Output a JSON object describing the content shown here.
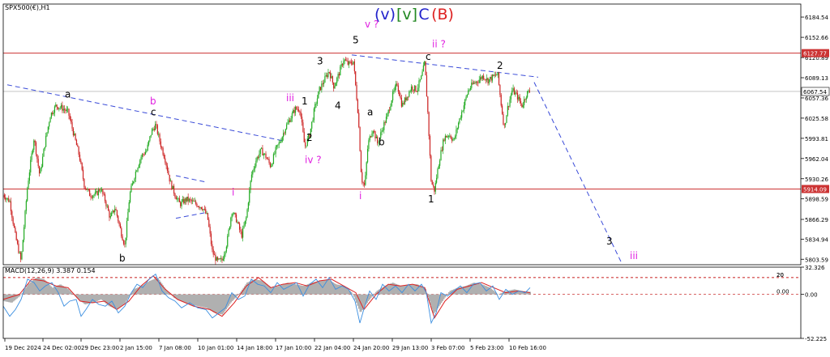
{
  "chart_data": {
    "type": "candlestick",
    "symbol": "SPX500(€),H1",
    "title_parts": [
      {
        "text": "(v)",
        "color": "#2222cc",
        "x": 475,
        "boxed": false
      },
      {
        "text": "[v]",
        "color": "#228822",
        "x": 502,
        "boxed": true
      },
      {
        "text": "C",
        "color": "#2222cc",
        "x": 523,
        "boxed": false
      },
      {
        "text": "(B)",
        "color": "#dd2222",
        "x": 546,
        "boxed": false
      }
    ],
    "ylim": [
      5795,
      6205
    ],
    "yticks": [
      6184.54,
      6152.66,
      6120.89,
      6089.13,
      6057.36,
      6025.58,
      5993.81,
      5962.04,
      5930.26,
      5898.59,
      5866.29,
      5834.94,
      5803.59
    ],
    "xticks": [
      "19 Dec 2024",
      "24 Dec 02:00",
      "29 Dec 23:00",
      "2 Jan 15:00",
      "7 Jan 08:00",
      "10 Jan 01:00",
      "14 Jan 18:00",
      "17 Jan 10:00",
      "22 Jan 04:00",
      "24 Jan 20:00",
      "29 Jan 13:00",
      "3 Feb 07:00",
      "5 Feb 23:00",
      "10 Feb 16:00"
    ],
    "horizontal_levels": [
      {
        "value": 6127.77,
        "label": "6127.77",
        "color": "#cc3333"
      },
      {
        "value": 5914.09,
        "label": "5914.09",
        "color": "#cc3333"
      }
    ],
    "current_price": {
      "value": 6067.54,
      "label": "6067.54"
    },
    "price_path": [
      [
        0,
        5905
      ],
      [
        8,
        5895
      ],
      [
        15,
        5840
      ],
      [
        22,
        5800
      ],
      [
        30,
        5920
      ],
      [
        38,
        5995
      ],
      [
        45,
        5935
      ],
      [
        52,
        5990
      ],
      [
        58,
        6030
      ],
      [
        65,
        6045
      ],
      [
        72,
        6042
      ],
      [
        80,
        6035
      ],
      [
        87,
        6000
      ],
      [
        94,
        5965
      ],
      [
        100,
        5920
      ],
      [
        107,
        5905
      ],
      [
        114,
        5905
      ],
      [
        120,
        5915
      ],
      [
        126,
        5895
      ],
      [
        132,
        5868
      ],
      [
        138,
        5885
      ],
      [
        145,
        5848
      ],
      [
        150,
        5825
      ],
      [
        156,
        5905
      ],
      [
        163,
        5940
      ],
      [
        170,
        5965
      ],
      [
        177,
        5975
      ],
      [
        183,
        6005
      ],
      [
        188,
        6015
      ],
      [
        194,
        5985
      ],
      [
        200,
        5960
      ],
      [
        206,
        5925
      ],
      [
        212,
        5905
      ],
      [
        218,
        5890
      ],
      [
        226,
        5898
      ],
      [
        236,
        5892
      ],
      [
        246,
        5885
      ],
      [
        252,
        5870
      ],
      [
        258,
        5815
      ],
      [
        264,
        5800
      ],
      [
        270,
        5802
      ],
      [
        276,
        5830
      ],
      [
        282,
        5880
      ],
      [
        288,
        5865
      ],
      [
        294,
        5840
      ],
      [
        300,
        5870
      ],
      [
        306,
        5935
      ],
      [
        312,
        5960
      ],
      [
        318,
        5975
      ],
      [
        324,
        5965
      ],
      [
        330,
        5950
      ],
      [
        336,
        5975
      ],
      [
        342,
        5990
      ],
      [
        348,
        6010
      ],
      [
        354,
        6025
      ],
      [
        360,
        6040
      ],
      [
        366,
        6040
      ],
      [
        372,
        5980
      ],
      [
        378,
        6000
      ],
      [
        384,
        6040
      ],
      [
        390,
        6070
      ],
      [
        396,
        6085
      ],
      [
        402,
        6100
      ],
      [
        408,
        6075
      ],
      [
        414,
        6095
      ],
      [
        420,
        6118
      ],
      [
        426,
        6110
      ],
      [
        432,
        6115
      ],
      [
        438,
        6030
      ],
      [
        442,
        5930
      ],
      [
        446,
        5918
      ],
      [
        450,
        5985
      ],
      [
        456,
        6010
      ],
      [
        462,
        5985
      ],
      [
        468,
        6010
      ],
      [
        474,
        6030
      ],
      [
        480,
        6060
      ],
      [
        486,
        6080
      ],
      [
        492,
        6045
      ],
      [
        498,
        6060
      ],
      [
        504,
        6075
      ],
      [
        510,
        6070
      ],
      [
        516,
        6090
      ],
      [
        520,
        6113
      ],
      [
        524,
        6030
      ],
      [
        528,
        5925
      ],
      [
        532,
        5912
      ],
      [
        538,
        5960
      ],
      [
        544,
        5995
      ],
      [
        550,
        6000
      ],
      [
        556,
        5990
      ],
      [
        562,
        6020
      ],
      [
        568,
        6045
      ],
      [
        574,
        6070
      ],
      [
        580,
        6080
      ],
      [
        586,
        6085
      ],
      [
        592,
        6092
      ],
      [
        598,
        6085
      ],
      [
        604,
        6090
      ],
      [
        610,
        6095
      ],
      [
        614,
        6050
      ],
      [
        618,
        6010
      ],
      [
        622,
        6040
      ],
      [
        628,
        6070
      ],
      [
        634,
        6060
      ],
      [
        640,
        6045
      ],
      [
        646,
        6065
      ],
      [
        650,
        6068
      ]
    ],
    "trendlines": [
      {
        "name": "upper-channel",
        "points": [
          [
            430,
            6125
          ],
          [
            660,
            6090
          ]
        ],
        "color": "#3a4bd8"
      },
      {
        "name": "left-channel",
        "points": [
          [
            5,
            6078
          ],
          [
            345,
            5990
          ]
        ],
        "color": "#3a4bd8"
      },
      {
        "name": "projection",
        "points": [
          [
            655,
            6082
          ],
          [
            762,
            5800
          ]
        ],
        "color": "#3a4bd8"
      },
      {
        "name": "small-channel-upper",
        "points": [
          [
            213,
            5935
          ],
          [
            250,
            5925
          ]
        ],
        "color": "#3a4bd8"
      },
      {
        "name": "small-channel-lower",
        "points": [
          [
            213,
            5868
          ],
          [
            250,
            5877
          ]
        ],
        "color": "#3a4bd8"
      }
    ],
    "wave_labels": [
      {
        "text": "a",
        "x": 80,
        "v": 6058,
        "color": "#000000"
      },
      {
        "text": "b",
        "x": 185,
        "v": 6047,
        "color": "#e020e0"
      },
      {
        "text": "c",
        "x": 186,
        "v": 6030,
        "color": "#000000"
      },
      {
        "text": "b",
        "x": 147,
        "v": 5800,
        "color": "#000000"
      },
      {
        "text": "i",
        "x": 286,
        "v": 5904,
        "color": "#e020e0"
      },
      {
        "text": "iii",
        "x": 353,
        "v": 6052,
        "color": "#e020e0"
      },
      {
        "text": "1",
        "x": 372,
        "v": 6047,
        "color": "#000000"
      },
      {
        "text": "2",
        "x": 378,
        "v": 5990,
        "color": "#000000"
      },
      {
        "text": "iv ?",
        "x": 376,
        "v": 5955,
        "color": "#e020e0"
      },
      {
        "text": "3",
        "x": 391,
        "v": 6110,
        "color": "#000000"
      },
      {
        "text": "4",
        "x": 413,
        "v": 6040,
        "color": "#000000"
      },
      {
        "text": "5",
        "x": 435,
        "v": 6143,
        "color": "#000000"
      },
      {
        "text": "v ?",
        "x": 450,
        "v": 6168,
        "color": "#e020e0"
      },
      {
        "text": "a",
        "x": 453,
        "v": 6030,
        "color": "#000000"
      },
      {
        "text": "b",
        "x": 467,
        "v": 5983,
        "color": "#000000"
      },
      {
        "text": "i",
        "x": 443,
        "v": 5898,
        "color": "#e020e0"
      },
      {
        "text": "ii ?",
        "x": 533,
        "v": 6137,
        "color": "#e020e0"
      },
      {
        "text": "c",
        "x": 525,
        "v": 6117,
        "color": "#000000"
      },
      {
        "text": "1",
        "x": 528,
        "v": 5893,
        "color": "#000000"
      },
      {
        "text": "2",
        "x": 613,
        "v": 6103,
        "color": "#000000"
      },
      {
        "text": "3",
        "x": 748,
        "v": 5827,
        "color": "#000000"
      },
      {
        "text": "iii",
        "x": 777,
        "v": 5804,
        "color": "#e020e0"
      }
    ],
    "macd": {
      "label": "MACD(12,26,9) 3.387 0.154",
      "ylim": [
        -52.225,
        32.326
      ],
      "yticks": [
        32.326,
        0.0,
        -52.225
      ],
      "levels": [
        20,
        0,
        -20
      ],
      "level_labels": [
        "20",
        "0.00",
        "20"
      ],
      "histogram": [
        [
          0,
          -8
        ],
        [
          10,
          -10
        ],
        [
          20,
          -2
        ],
        [
          30,
          12
        ],
        [
          40,
          20
        ],
        [
          50,
          18
        ],
        [
          60,
          8
        ],
        [
          70,
          12
        ],
        [
          80,
          6
        ],
        [
          90,
          -4
        ],
        [
          100,
          -12
        ],
        [
          110,
          -10
        ],
        [
          120,
          -6
        ],
        [
          130,
          -14
        ],
        [
          140,
          -18
        ],
        [
          150,
          -10
        ],
        [
          160,
          6
        ],
        [
          170,
          10
        ],
        [
          180,
          16
        ],
        [
          190,
          20
        ],
        [
          200,
          6
        ],
        [
          210,
          -4
        ],
        [
          220,
          -8
        ],
        [
          230,
          -12
        ],
        [
          240,
          -14
        ],
        [
          250,
          -16
        ],
        [
          260,
          -22
        ],
        [
          270,
          -24
        ],
        [
          280,
          -10
        ],
        [
          290,
          0
        ],
        [
          300,
          14
        ],
        [
          310,
          18
        ],
        [
          320,
          16
        ],
        [
          330,
          8
        ],
        [
          340,
          10
        ],
        [
          350,
          14
        ],
        [
          360,
          12
        ],
        [
          370,
          10
        ],
        [
          380,
          14
        ],
        [
          390,
          16
        ],
        [
          400,
          18
        ],
        [
          410,
          12
        ],
        [
          420,
          10
        ],
        [
          430,
          2
        ],
        [
          440,
          -22
        ],
        [
          450,
          -8
        ],
        [
          460,
          4
        ],
        [
          470,
          10
        ],
        [
          480,
          14
        ],
        [
          490,
          10
        ],
        [
          500,
          12
        ],
        [
          510,
          12
        ],
        [
          520,
          8
        ],
        [
          530,
          -24
        ],
        [
          540,
          -10
        ],
        [
          550,
          4
        ],
        [
          560,
          8
        ],
        [
          570,
          10
        ],
        [
          580,
          14
        ],
        [
          590,
          12
        ],
        [
          600,
          8
        ],
        [
          610,
          0
        ],
        [
          620,
          4
        ],
        [
          630,
          6
        ],
        [
          640,
          4
        ],
        [
          650,
          3
        ]
      ],
      "signal": [
        [
          0,
          -6
        ],
        [
          20,
          0
        ],
        [
          35,
          18
        ],
        [
          50,
          16
        ],
        [
          65,
          10
        ],
        [
          80,
          8
        ],
        [
          95,
          -8
        ],
        [
          110,
          -10
        ],
        [
          125,
          -8
        ],
        [
          140,
          -18
        ],
        [
          155,
          -8
        ],
        [
          170,
          10
        ],
        [
          185,
          22
        ],
        [
          200,
          6
        ],
        [
          215,
          -6
        ],
        [
          235,
          -14
        ],
        [
          255,
          -18
        ],
        [
          270,
          -26
        ],
        [
          285,
          -10
        ],
        [
          300,
          10
        ],
        [
          315,
          20
        ],
        [
          330,
          8
        ],
        [
          345,
          12
        ],
        [
          360,
          14
        ],
        [
          375,
          10
        ],
        [
          390,
          16
        ],
        [
          405,
          18
        ],
        [
          420,
          10
        ],
        [
          435,
          2
        ],
        [
          445,
          -18
        ],
        [
          460,
          0
        ],
        [
          475,
          12
        ],
        [
          490,
          10
        ],
        [
          505,
          12
        ],
        [
          520,
          8
        ],
        [
          532,
          -28
        ],
        [
          545,
          -8
        ],
        [
          560,
          6
        ],
        [
          575,
          10
        ],
        [
          590,
          14
        ],
        [
          605,
          8
        ],
        [
          620,
          2
        ],
        [
          635,
          4
        ],
        [
          650,
          2
        ]
      ],
      "macd_line": [
        [
          0,
          -14
        ],
        [
          8,
          -26
        ],
        [
          15,
          -18
        ],
        [
          22,
          -6
        ],
        [
          30,
          18
        ],
        [
          38,
          14
        ],
        [
          45,
          4
        ],
        [
          52,
          10
        ],
        [
          60,
          14
        ],
        [
          68,
          2
        ],
        [
          75,
          -14
        ],
        [
          82,
          -8
        ],
        [
          90,
          -6
        ],
        [
          96,
          -26
        ],
        [
          102,
          -18
        ],
        [
          110,
          -6
        ],
        [
          118,
          -12
        ],
        [
          126,
          -14
        ],
        [
          134,
          -8
        ],
        [
          142,
          -22
        ],
        [
          150,
          -14
        ],
        [
          158,
          2
        ],
        [
          165,
          12
        ],
        [
          172,
          8
        ],
        [
          180,
          18
        ],
        [
          188,
          24
        ],
        [
          196,
          4
        ],
        [
          204,
          -4
        ],
        [
          212,
          -8
        ],
        [
          220,
          -16
        ],
        [
          230,
          -10
        ],
        [
          240,
          -16
        ],
        [
          250,
          -18
        ],
        [
          258,
          -28
        ],
        [
          266,
          -22
        ],
        [
          274,
          -16
        ],
        [
          282,
          2
        ],
        [
          290,
          -6
        ],
        [
          298,
          -2
        ],
        [
          306,
          18
        ],
        [
          314,
          12
        ],
        [
          322,
          10
        ],
        [
          330,
          2
        ],
        [
          338,
          14
        ],
        [
          346,
          6
        ],
        [
          354,
          10
        ],
        [
          362,
          14
        ],
        [
          370,
          -2
        ],
        [
          378,
          12
        ],
        [
          386,
          18
        ],
        [
          394,
          8
        ],
        [
          402,
          20
        ],
        [
          410,
          6
        ],
        [
          418,
          10
        ],
        [
          426,
          6
        ],
        [
          434,
          -8
        ],
        [
          440,
          -34
        ],
        [
          446,
          -14
        ],
        [
          452,
          4
        ],
        [
          460,
          -6
        ],
        [
          468,
          12
        ],
        [
          476,
          4
        ],
        [
          484,
          10
        ],
        [
          492,
          2
        ],
        [
          500,
          12
        ],
        [
          508,
          4
        ],
        [
          516,
          12
        ],
        [
          522,
          2
        ],
        [
          528,
          -34
        ],
        [
          534,
          -22
        ],
        [
          540,
          2
        ],
        [
          548,
          -2
        ],
        [
          556,
          4
        ],
        [
          564,
          10
        ],
        [
          572,
          2
        ],
        [
          580,
          12
        ],
        [
          588,
          14
        ],
        [
          596,
          4
        ],
        [
          604,
          10
        ],
        [
          612,
          -6
        ],
        [
          620,
          6
        ],
        [
          628,
          0
        ],
        [
          636,
          4
        ],
        [
          644,
          2
        ],
        [
          650,
          8
        ]
      ]
    }
  }
}
